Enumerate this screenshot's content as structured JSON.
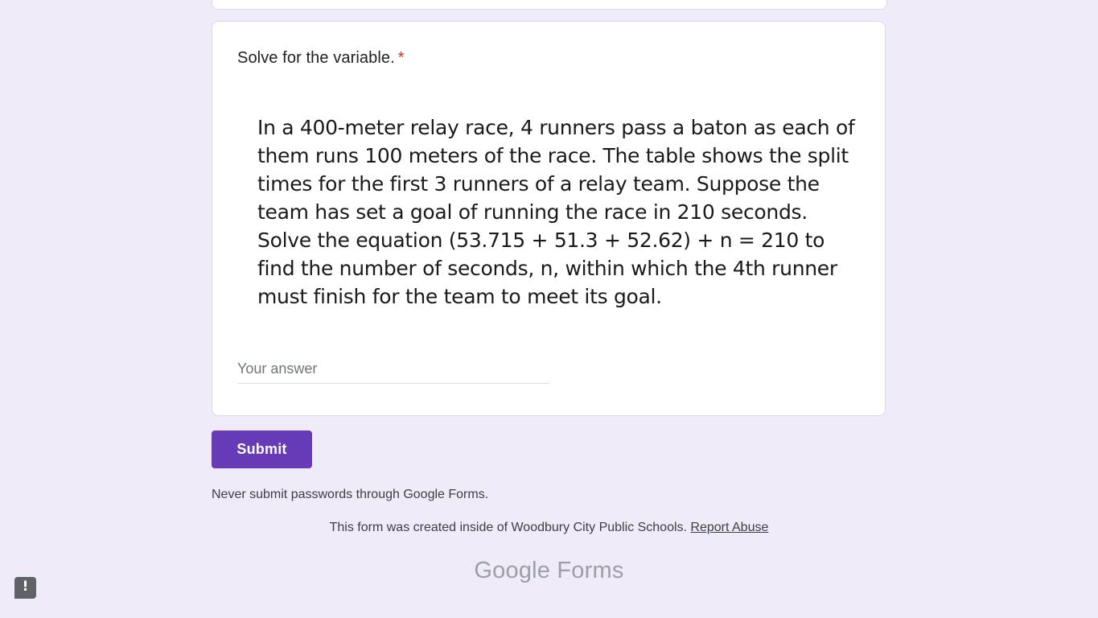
{
  "question": {
    "title": "Solve for the variable.",
    "required_marker": "*",
    "image_text_lines": [
      "In a 400-meter relay race, 4 runners pass a baton as each of",
      "them runs 100 meters of the race. The table shows the split",
      "times for the first 3 runners of a relay team. Suppose the",
      "team has set a goal of running the race in 210 seconds.",
      "Solve the equation (53.715 + 51.3 + 52.62) + n = 210 to",
      "find the number of seconds, n, within which the 4th runner",
      "must finish for the team to meet its goal."
    ],
    "answer_placeholder": "Your answer",
    "answer_value": ""
  },
  "submit_label": "Submit",
  "footer": {
    "password_warning": "Never submit passwords through Google Forms.",
    "created_text": "This form was created inside of Woodbury City Public Schools.",
    "report_link": "Report Abuse",
    "logo_text": "Google Forms"
  },
  "feedback_icon": "!",
  "colors": {
    "background": "#f0ebf8",
    "accent": "#673ab7",
    "required": "#d93025"
  }
}
